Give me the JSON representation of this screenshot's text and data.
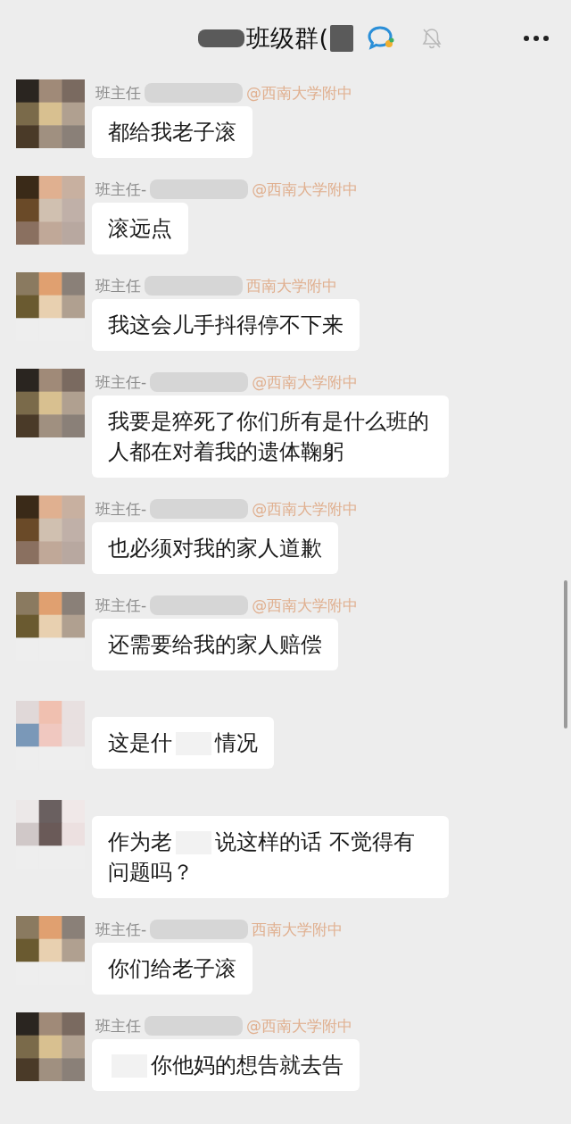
{
  "header": {
    "title_parts": [
      {
        "kind": "redacted"
      },
      {
        "kind": "text",
        "text": "班级群("
      },
      {
        "kind": "redacted"
      }
    ]
  },
  "messages": [
    {
      "kind": "named",
      "name_parts": [
        {
          "kind": "text",
          "text": "班主任"
        },
        {
          "kind": "redacted"
        },
        {
          "kind": "school",
          "text": "@西南大学附中"
        }
      ],
      "text_parts": [
        {
          "kind": "text",
          "text": "都给我老子滚"
        }
      ]
    },
    {
      "kind": "named",
      "name_parts": [
        {
          "kind": "text",
          "text": "班主任-"
        },
        {
          "kind": "redacted"
        },
        {
          "kind": "school",
          "text": "@西南大学附中"
        }
      ],
      "text_parts": [
        {
          "kind": "text",
          "text": "滚远点"
        }
      ]
    },
    {
      "kind": "named",
      "name_parts": [
        {
          "kind": "text",
          "text": "班主任"
        },
        {
          "kind": "redacted"
        },
        {
          "kind": "school",
          "text": "西南大学附中"
        }
      ],
      "text_parts": [
        {
          "kind": "text",
          "text": "我这会儿手抖得停不下来"
        }
      ]
    },
    {
      "kind": "named",
      "name_parts": [
        {
          "kind": "text",
          "text": "班主任-"
        },
        {
          "kind": "redacted"
        },
        {
          "kind": "school",
          "text": "@西南大学附中"
        }
      ],
      "text_parts": [
        {
          "kind": "text",
          "text": "我要是猝死了你们所有是什么班的人都在对着我的遗体鞠躬"
        }
      ]
    },
    {
      "kind": "named",
      "name_parts": [
        {
          "kind": "text",
          "text": "班主任-"
        },
        {
          "kind": "redacted"
        },
        {
          "kind": "school",
          "text": "@西南大学附中"
        }
      ],
      "text_parts": [
        {
          "kind": "text",
          "text": "也必须对我的家人道歉"
        }
      ]
    },
    {
      "kind": "named",
      "name_parts": [
        {
          "kind": "text",
          "text": "班主任-"
        },
        {
          "kind": "redacted"
        },
        {
          "kind": "school",
          "text": "@西南大学附中"
        }
      ],
      "text_parts": [
        {
          "kind": "text",
          "text": "还需要给我的家人赔偿"
        }
      ]
    },
    {
      "kind": "anonymous",
      "text_parts": [
        {
          "kind": "text",
          "text": "这是什"
        },
        {
          "kind": "redacted"
        },
        {
          "kind": "text",
          "text": "情况"
        }
      ]
    },
    {
      "kind": "anonymous",
      "text_parts": [
        {
          "kind": "text",
          "text": "作为老"
        },
        {
          "kind": "redacted"
        },
        {
          "kind": "text",
          "text": "说这样的话 不觉得有问题吗？"
        }
      ]
    },
    {
      "kind": "named",
      "name_parts": [
        {
          "kind": "text",
          "text": "班主任-"
        },
        {
          "kind": "redacted"
        },
        {
          "kind": "school",
          "text": "西南大学附中"
        }
      ],
      "text_parts": [
        {
          "kind": "text",
          "text": "你们给老子滚"
        }
      ]
    },
    {
      "kind": "named",
      "name_parts": [
        {
          "kind": "text",
          "text": "班主任"
        },
        {
          "kind": "redacted"
        },
        {
          "kind": "school",
          "text": "@西南大学附中"
        }
      ],
      "text_parts": [
        {
          "kind": "redacted"
        },
        {
          "kind": "text",
          "text": "你他妈的想告就去告"
        }
      ]
    }
  ]
}
